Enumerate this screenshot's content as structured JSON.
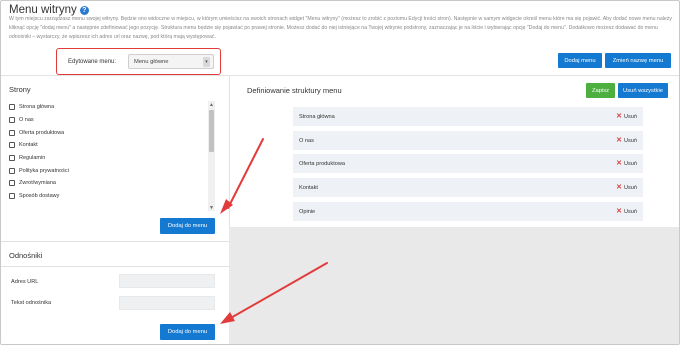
{
  "page": {
    "title": "Menu witryny",
    "intro": "W tym miejscu zarządzasz menu swojej witryny. Będzie ono widoczne w miejscu, w którym umieścisz na swoich stronach widget \"Menu witryny\" (możesz to zrobić z poziomu Edycji treści stron). Następnie w samym widgecie określ menu które ma się pojawić. Aby dodać nowe menu należy kliknąć opcję \"dodaj menu\" a następnie zdefiniować jego pozycję. Struktura menu będzie się pojawiać po prawej stronie. Możesz dodać do niej istniejące na Twojej witrynie podstrony, zaznaczając je na liście i wybierając opcję \"Dodaj do menu\". Dodatkowo możesz dodawać do menu odnośniki – wystarczy, że wpiszesz ich adres url oraz nazwę, pod którą mają występować."
  },
  "menu_select": {
    "label": "Edytowane menu:",
    "value": "Menu główne"
  },
  "top_buttons": {
    "add_menu": "Dodaj menu",
    "rename_menu": "Zmień nazwę menu"
  },
  "pages_panel": {
    "title": "Strony",
    "items": [
      "Strona główna",
      "O nas",
      "Oferta produktowa",
      "Kontakt",
      "Regulamin",
      "Polityka prywatności",
      "Zwrot/wymiana",
      "Sposób dostawy"
    ],
    "add_button": "Dodaj do menu"
  },
  "links_panel": {
    "title": "Odnośniki",
    "url_label": "Adres URL",
    "text_label": "Tekst odnośnika",
    "add_button": "Dodaj do menu"
  },
  "structure": {
    "title": "Definiowanie struktury menu",
    "save_button": "Zapisz",
    "delete_all_button": "Usuń wszystkie",
    "items": [
      "Strona główna",
      "O nas",
      "Oferta produktowa",
      "Kontakt",
      "Opinie"
    ],
    "remove_label": "Usuń"
  },
  "colors": {
    "accent": "#1479d0",
    "save": "#4caf3f",
    "highlight": "#e23b3b"
  }
}
